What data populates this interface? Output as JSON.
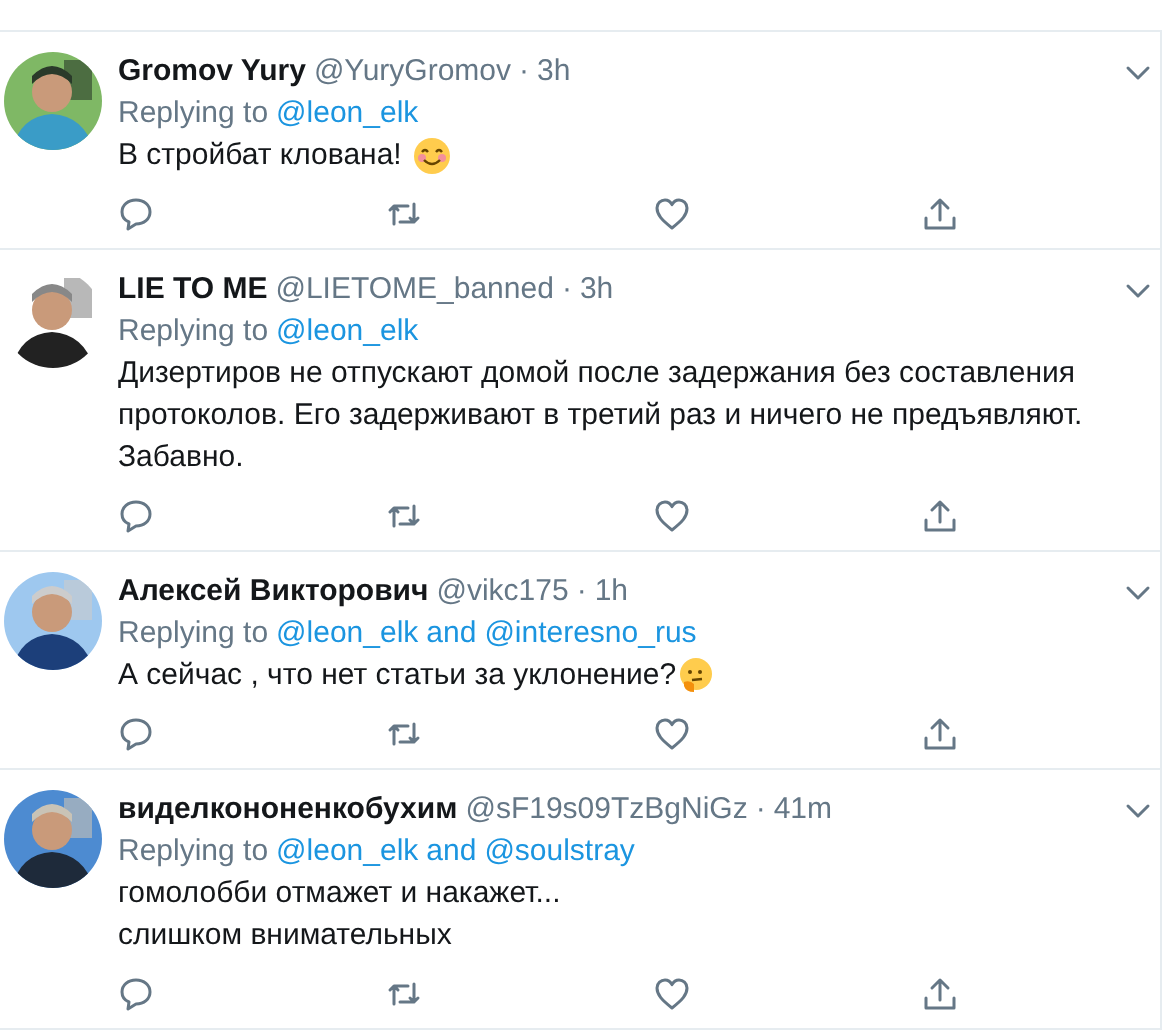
{
  "tweets": [
    {
      "name": "Gromov Yury",
      "handle": "@YuryGromov",
      "separator": "·",
      "time": "3h",
      "replying": {
        "prefix": "Replying to",
        "mentions": [
          "@leon_elk"
        ]
      },
      "text": "В стройбат клована!",
      "emoji": {
        "kind": "smiling"
      }
    },
    {
      "name": "LIE TO ME",
      "handle": "@LIETOME_banned",
      "separator": "·",
      "time": "3h",
      "replying": {
        "prefix": "Replying to",
        "mentions": [
          "@leon_elk"
        ]
      },
      "text": "Дизертиров не отпускают домой после задержания без составления протоколов. Его задерживают в третий раз и ничего не предъявляют. Забавно."
    },
    {
      "name": "Алексей Викторович",
      "handle": "@vikc175",
      "separator": "·",
      "time": "1h",
      "replying": {
        "prefix": "Replying to",
        "mentions": [
          "@leon_elk",
          "@interesno_rus"
        ],
        "joiner": "and"
      },
      "text": "А сейчас , что нет статьи за уклонение?",
      "emoji": {
        "kind": "thinking"
      }
    },
    {
      "name": "виделкононенкобухим",
      "handle": "@sF19s09TzBgNiGz",
      "separator": "·",
      "time": "41m",
      "replying": {
        "prefix": "Replying to",
        "mentions": [
          "@leon_elk",
          "@soulstray"
        ],
        "joiner": "and"
      },
      "text": "гомолобби отмажет и накажет...",
      "text_2": "слишком внимательных"
    }
  ]
}
